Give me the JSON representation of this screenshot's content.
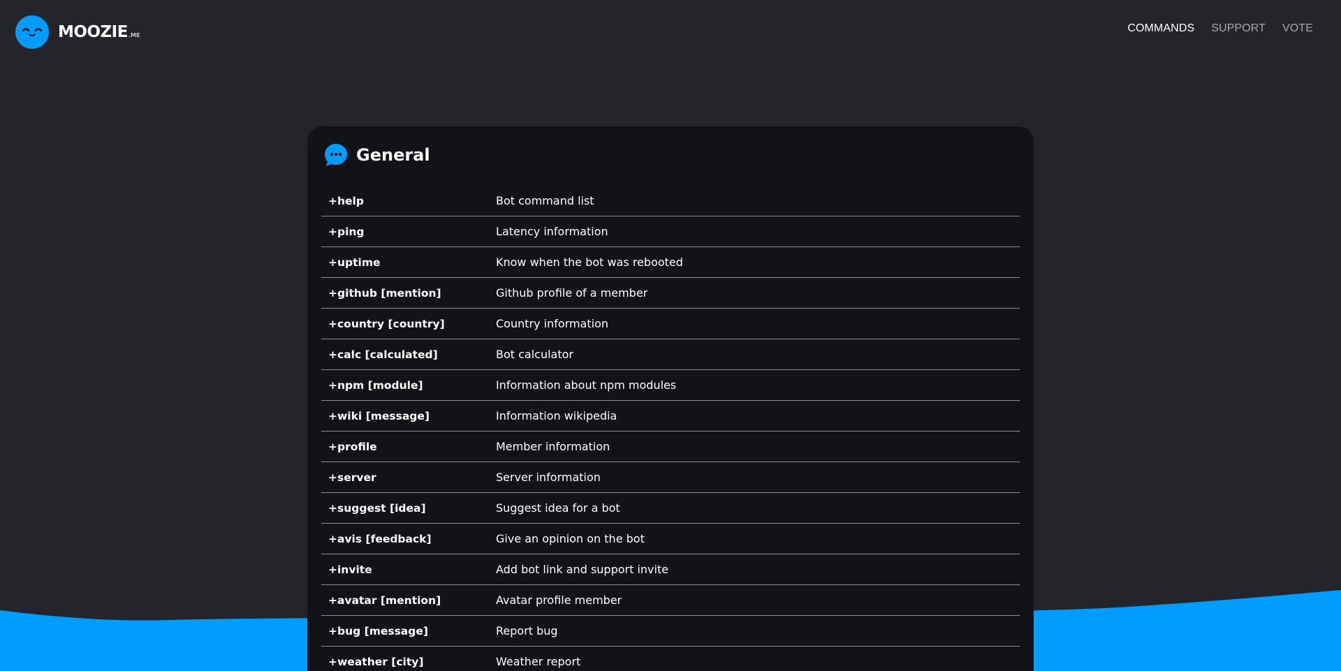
{
  "colors": {
    "background": "#24252b",
    "card": "#121317",
    "accent": "#009cff",
    "divider": "#8e8f94",
    "nav_inactive": "#a8a9ae",
    "text": "#ffffff"
  },
  "brand": {
    "name": "MOOZIE",
    "suffix": ".ME",
    "logo_icon": "smiley-face-icon"
  },
  "nav": {
    "items": [
      {
        "label": "COMMANDS",
        "active": true
      },
      {
        "label": "SUPPORT",
        "active": false
      },
      {
        "label": "VOTE",
        "active": false
      }
    ]
  },
  "section": {
    "icon": "chat-bubble-icon",
    "title": "General",
    "commands": [
      {
        "name": "+help",
        "description": "Bot command list"
      },
      {
        "name": "+ping",
        "description": "Latency information"
      },
      {
        "name": "+uptime",
        "description": "Know when the bot was rebooted"
      },
      {
        "name": "+github [mention]",
        "description": "Github profile of a member"
      },
      {
        "name": "+country [country]",
        "description": "Country information"
      },
      {
        "name": "+calc [calculated]",
        "description": "Bot calculator"
      },
      {
        "name": "+npm [module]",
        "description": "Information about npm modules"
      },
      {
        "name": "+wiki [message]",
        "description": "Information wikipedia"
      },
      {
        "name": "+profile",
        "description": "Member information"
      },
      {
        "name": "+server",
        "description": "Server information"
      },
      {
        "name": "+suggest [idea]",
        "description": "Suggest idea for a bot"
      },
      {
        "name": "+avis [feedback]",
        "description": "Give an opinion on the bot"
      },
      {
        "name": "+invite",
        "description": "Add bot link and support invite"
      },
      {
        "name": "+avatar [mention]",
        "description": "Avatar profile member"
      },
      {
        "name": "+bug [message]",
        "description": "Report bug"
      },
      {
        "name": "+weather [city]",
        "description": "Weather report"
      }
    ]
  }
}
